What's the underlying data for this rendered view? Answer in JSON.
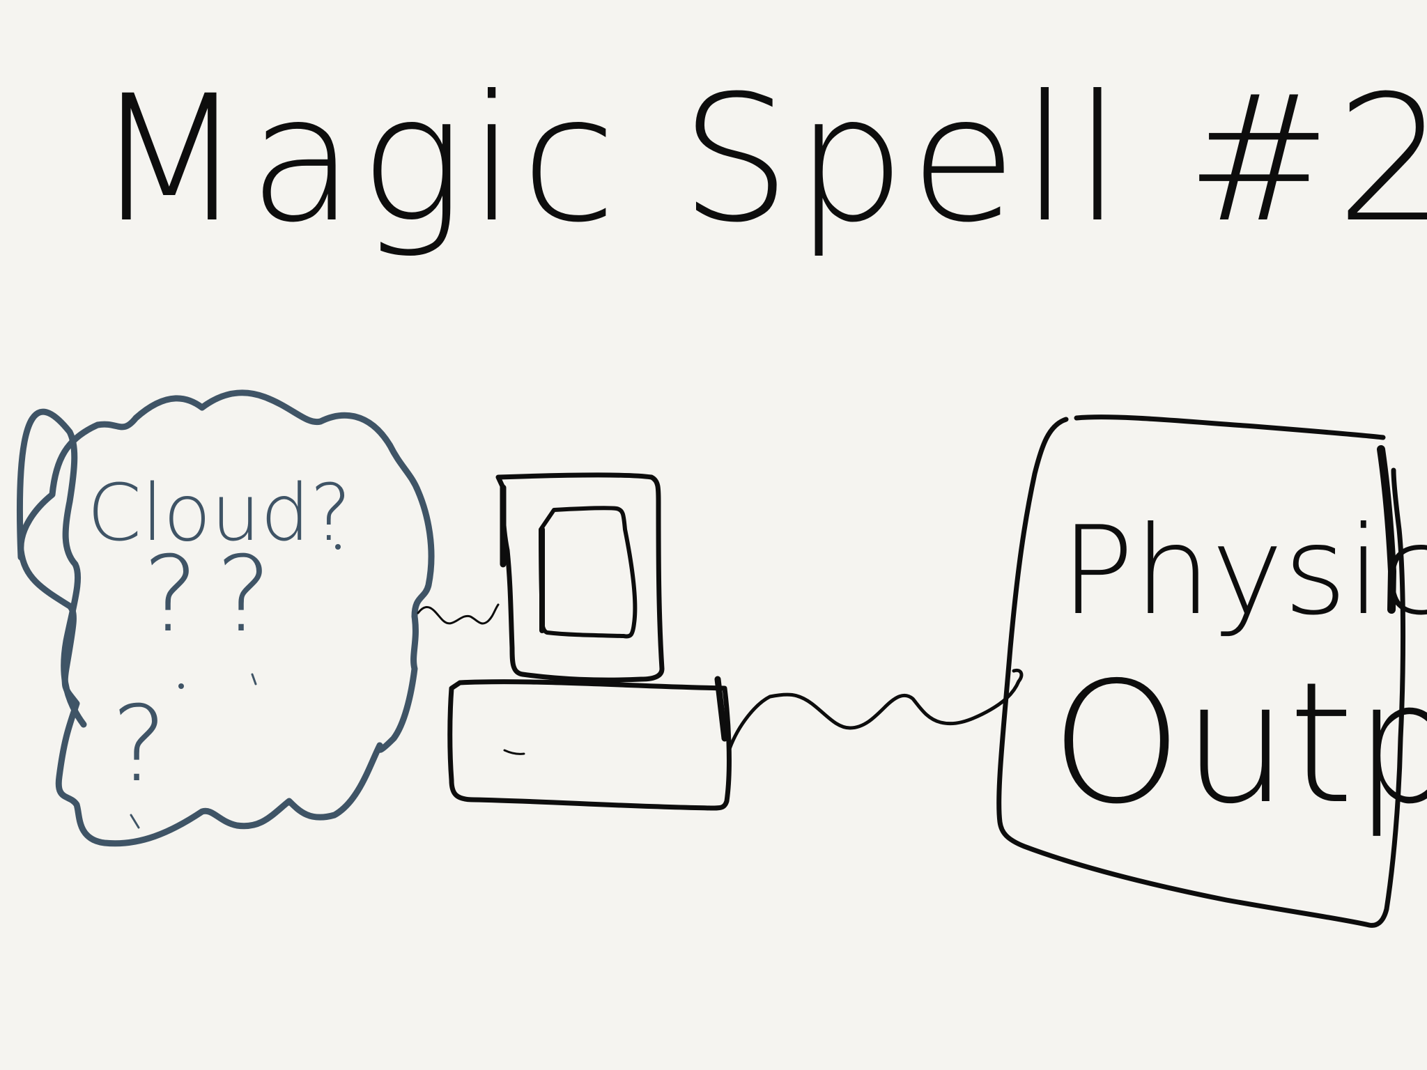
{
  "title": "Magic Spell #2",
  "cloud": {
    "label": "Cloud?",
    "question_marks": [
      "?",
      "?",
      "?"
    ]
  },
  "output": {
    "line1": "Physical",
    "line2": "Output"
  },
  "colors": {
    "background": "#f5f4f0",
    "ink": "#0d0d0d",
    "cloud_ink": "#3f5466"
  }
}
